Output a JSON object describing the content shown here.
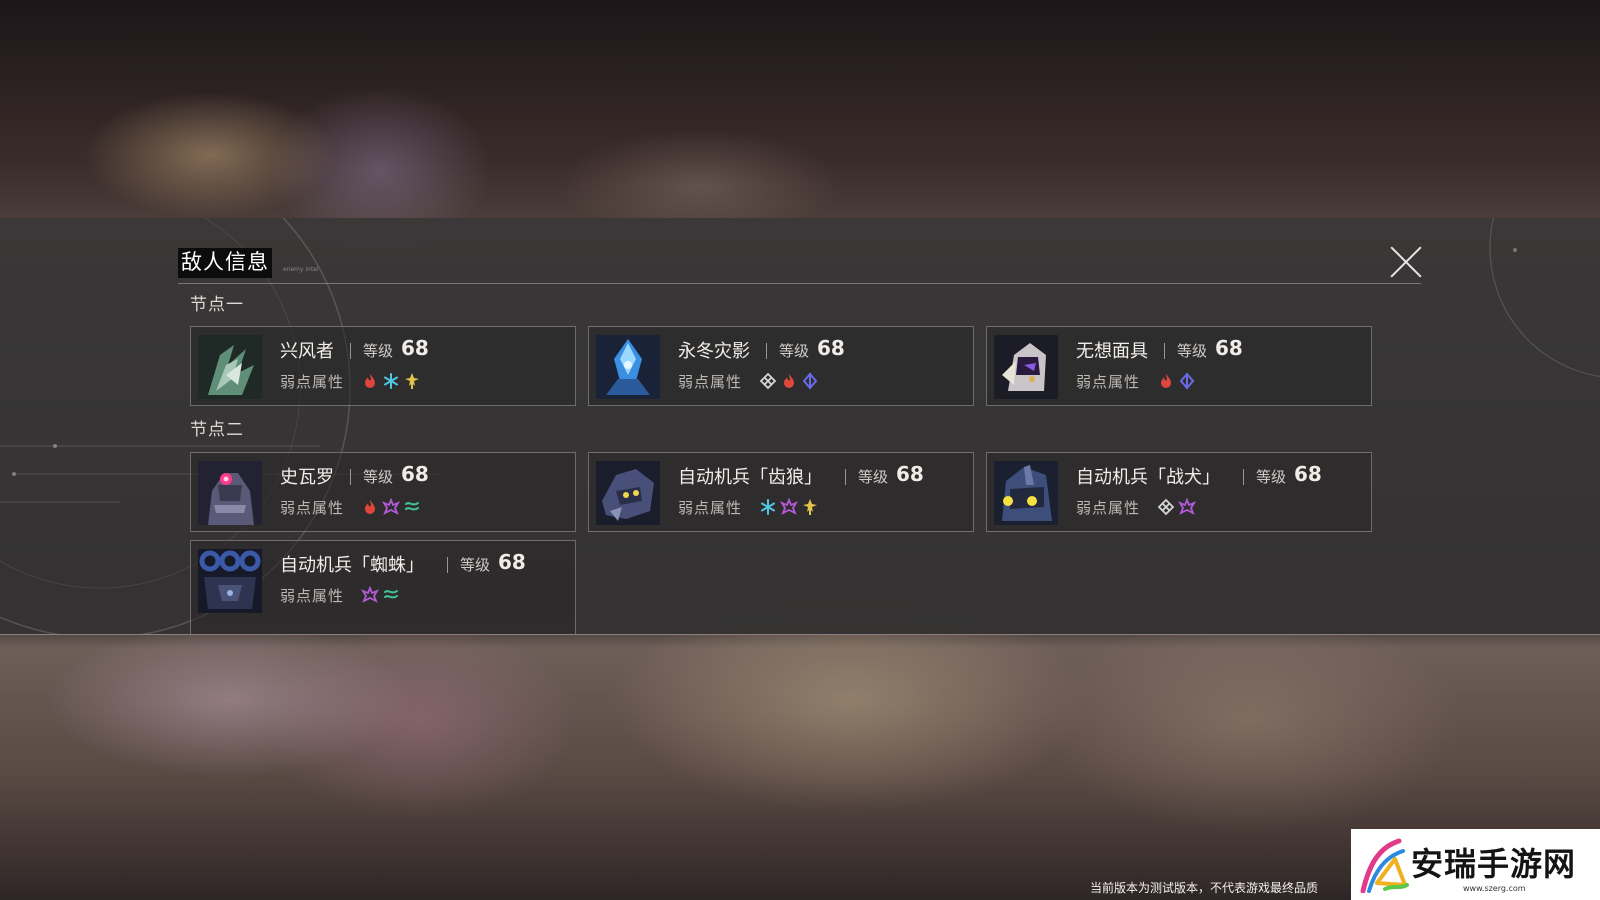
{
  "panel": {
    "title": "敌人信息",
    "subtitle": "enemy intel",
    "close_icon": "close-icon"
  },
  "sections": [
    {
      "label": "节点一",
      "enemies": [
        {
          "name": "兴风者",
          "level_label": "等级",
          "level": "68",
          "weak_label": "弱点属性",
          "portrait": "wind-warrior-portrait",
          "weaknesses": [
            "fire",
            "ice",
            "lightning"
          ]
        },
        {
          "name": "永冬灾影",
          "level_label": "等级",
          "level": "68",
          "weak_label": "弱点属性",
          "portrait": "ice-crystal-beast-portrait",
          "weaknesses": [
            "physical",
            "fire",
            "quantum"
          ]
        },
        {
          "name": "无想面具",
          "level_label": "等级",
          "level": "68",
          "weak_label": "弱点属性",
          "portrait": "mask-portrait",
          "weaknesses": [
            "fire",
            "quantum"
          ]
        }
      ]
    },
    {
      "label": "节点二",
      "enemies": [
        {
          "name": "史瓦罗",
          "level_label": "等级",
          "level": "68",
          "weak_label": "弱点属性",
          "portrait": "svarog-portrait",
          "weaknesses": [
            "fire",
            "imaginary",
            "wind"
          ]
        },
        {
          "name": "自动机兵「齿狼」",
          "level_label": "等级",
          "level": "68",
          "weak_label": "弱点属性",
          "portrait": "automaton-wolf-portrait",
          "weaknesses": [
            "ice",
            "imaginary",
            "lightning"
          ]
        },
        {
          "name": "自动机兵「战犬」",
          "level_label": "等级",
          "level": "68",
          "weak_label": "弱点属性",
          "portrait": "automaton-hound-portrait",
          "weaknesses": [
            "physical",
            "imaginary"
          ]
        },
        {
          "name": "自动机兵「蜘蛛」",
          "level_label": "等级",
          "level": "68",
          "weak_label": "弱点属性",
          "portrait": "automaton-spider-portrait",
          "weaknesses": [
            "imaginary",
            "wind"
          ]
        }
      ]
    }
  ],
  "element_colors": {
    "fire": "#e0463c",
    "ice": "#4fc6e6",
    "lightning": "#e4c34a",
    "physical": "#d6d6d6",
    "quantum": "#6a6ae8",
    "imaginary": "#b45ad8",
    "wind": "#3fc49a"
  },
  "footer_notice": "当前版本为测试版本，不代表游戏最终品质",
  "watermark": {
    "text": "安瑞手游网",
    "url": "www.szerg.com"
  }
}
